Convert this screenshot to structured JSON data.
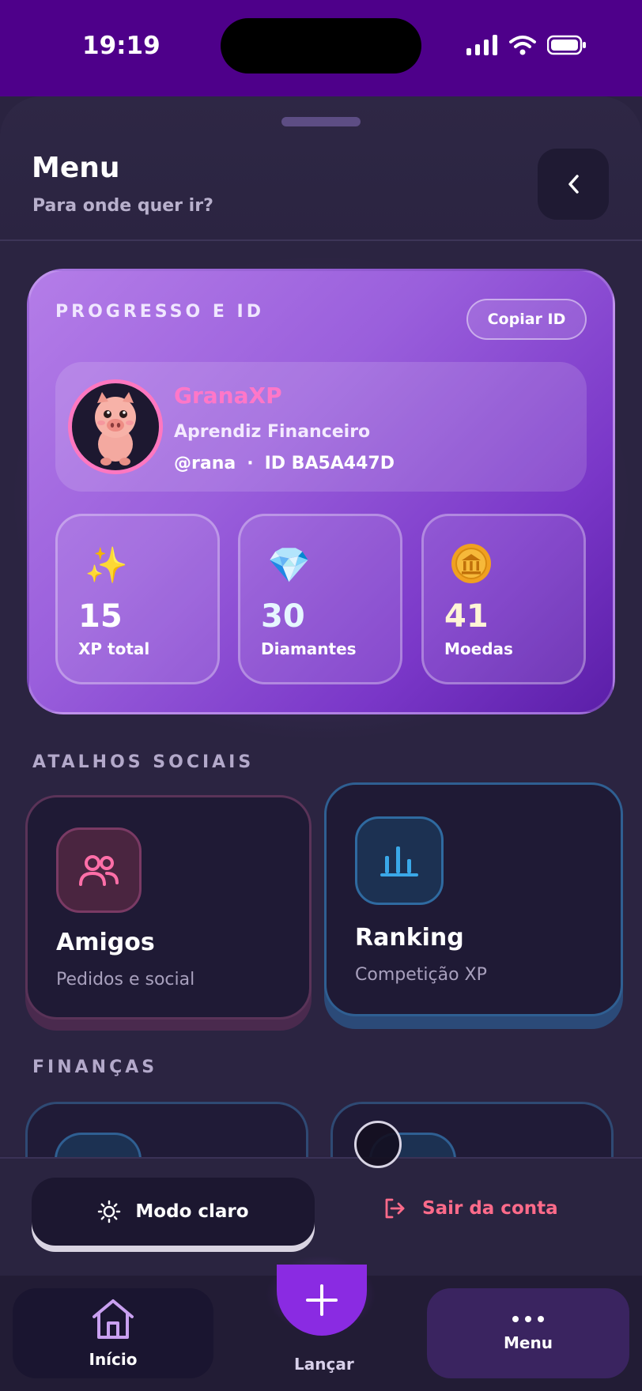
{
  "status_bar": {
    "time": "19:19"
  },
  "header": {
    "title": "Menu",
    "subtitle": "Para onde quer ir?"
  },
  "progress_card": {
    "label": "PROGRESSO E ID",
    "copy_button": "Copiar ID",
    "profile": {
      "name": "GranaXP",
      "role": "Aprendiz Financeiro",
      "handle": "@rana",
      "separator": "·",
      "id": "ID BA5A447D"
    },
    "stats": [
      {
        "icon": "sparkles-icon",
        "glyph": "✨",
        "value": "15",
        "label": "XP total"
      },
      {
        "icon": "diamond-icon",
        "glyph": "💎",
        "value": "30",
        "label": "Diamantes"
      },
      {
        "icon": "coin-icon",
        "glyph": "🪙",
        "value": "41",
        "label": "Moedas"
      }
    ]
  },
  "social_section": {
    "label": "ATALHOS SOCIAIS",
    "cards": [
      {
        "title": "Amigos",
        "subtitle": "Pedidos e social",
        "accent": "#ff6fa8"
      },
      {
        "title": "Ranking",
        "subtitle": "Competição XP",
        "accent": "#3aa8e8"
      }
    ]
  },
  "finance_section": {
    "label": "FINANÇAS"
  },
  "actions": {
    "theme_toggle": "Modo claro",
    "logout": "Sair da conta"
  },
  "tabbar": {
    "home": "Início",
    "add": "Lançar",
    "menu": "Menu"
  },
  "colors": {
    "accent_purple": "#8a2be2",
    "logout_red": "#ff6b8a",
    "name_pink": "#ff77c8"
  }
}
